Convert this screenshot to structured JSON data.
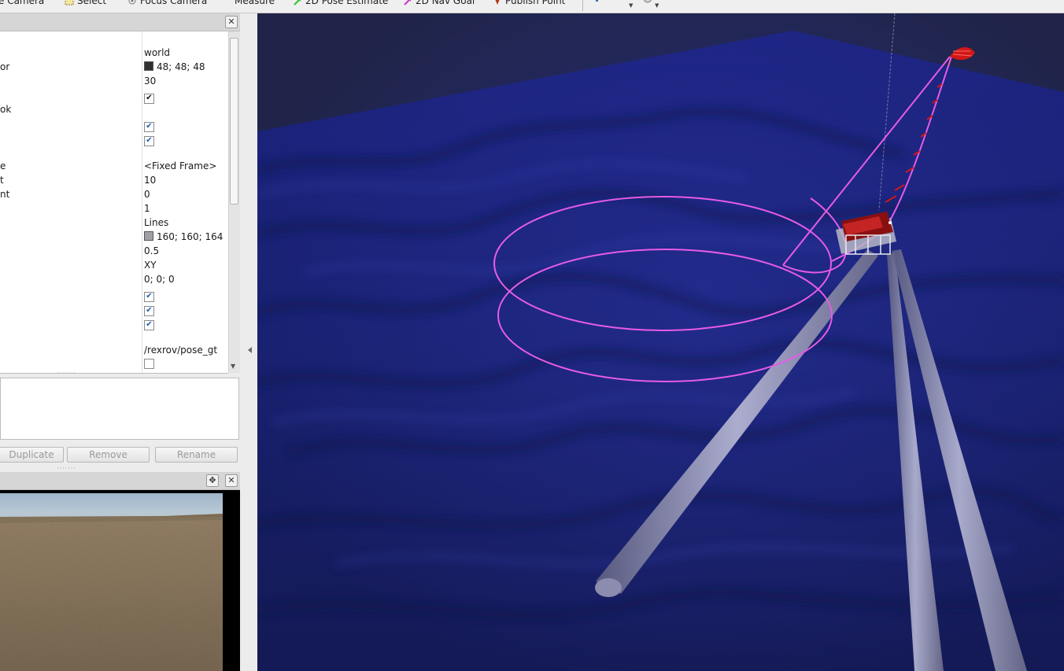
{
  "toolbar": {
    "items": [
      {
        "label": "e Camera",
        "icon": "camera-icon"
      },
      {
        "label": "Select",
        "icon": "select-icon"
      },
      {
        "label": "Focus Camera",
        "icon": "focus-camera-icon"
      },
      {
        "label": "Measure",
        "icon": "measure-icon"
      },
      {
        "label": "2D Pose Estimate",
        "icon": "pose-estimate-icon"
      },
      {
        "label": "2D Nav Goal",
        "icon": "nav-goal-icon"
      },
      {
        "label": "Publish Point",
        "icon": "publish-point-icon"
      }
    ],
    "colors": {
      "pose_estimate": "#2bbf2b",
      "nav_goal": "#cc33cc",
      "publish_point": "#b33a1a"
    }
  },
  "displays_panel": {
    "close_glyph": "✕",
    "properties": [
      {
        "name": "",
        "value": "world",
        "type": "text"
      },
      {
        "name": "or",
        "value": "48; 48; 48",
        "type": "color",
        "color": "#303030"
      },
      {
        "name": "",
        "value": "30",
        "type": "text"
      },
      {
        "name": "",
        "value": "✔",
        "type": "checkbox"
      },
      {
        "name": "ok",
        "value": "",
        "type": "text"
      },
      {
        "name": "",
        "value": "✔",
        "type": "checkbox"
      },
      {
        "name": "",
        "value": "✔",
        "type": "checkbox"
      },
      {
        "name": "",
        "value": "",
        "type": "text"
      },
      {
        "name": "e",
        "value": "<Fixed Frame>",
        "type": "text"
      },
      {
        "name": "t",
        "value": "10",
        "type": "text"
      },
      {
        "name": "nt",
        "value": "0",
        "type": "text"
      },
      {
        "name": "",
        "value": "1",
        "type": "text"
      },
      {
        "name": "",
        "value": "Lines",
        "type": "text"
      },
      {
        "name": "",
        "value": "160; 160; 164",
        "type": "color",
        "color": "#a0a0a4"
      },
      {
        "name": "",
        "value": "0.5",
        "type": "text"
      },
      {
        "name": "",
        "value": "XY",
        "type": "text"
      },
      {
        "name": "",
        "value": "0; 0; 0",
        "type": "text"
      },
      {
        "name": "",
        "value": "✔",
        "type": "checkbox"
      },
      {
        "name": "",
        "value": "✔",
        "type": "checkbox"
      },
      {
        "name": "",
        "value": "✔",
        "type": "checkbox"
      },
      {
        "name": "",
        "value": "",
        "type": "text"
      },
      {
        "name": "",
        "value": "/rexrov/pose_gt",
        "type": "text"
      },
      {
        "name": "",
        "value": "",
        "type": "checkbox-empty"
      }
    ],
    "buttons": {
      "duplicate": "Duplicate",
      "remove": "Remove",
      "rename": "Rename"
    }
  },
  "camera_panel": {
    "float_glyph": "✥",
    "close_glyph": "✕"
  }
}
